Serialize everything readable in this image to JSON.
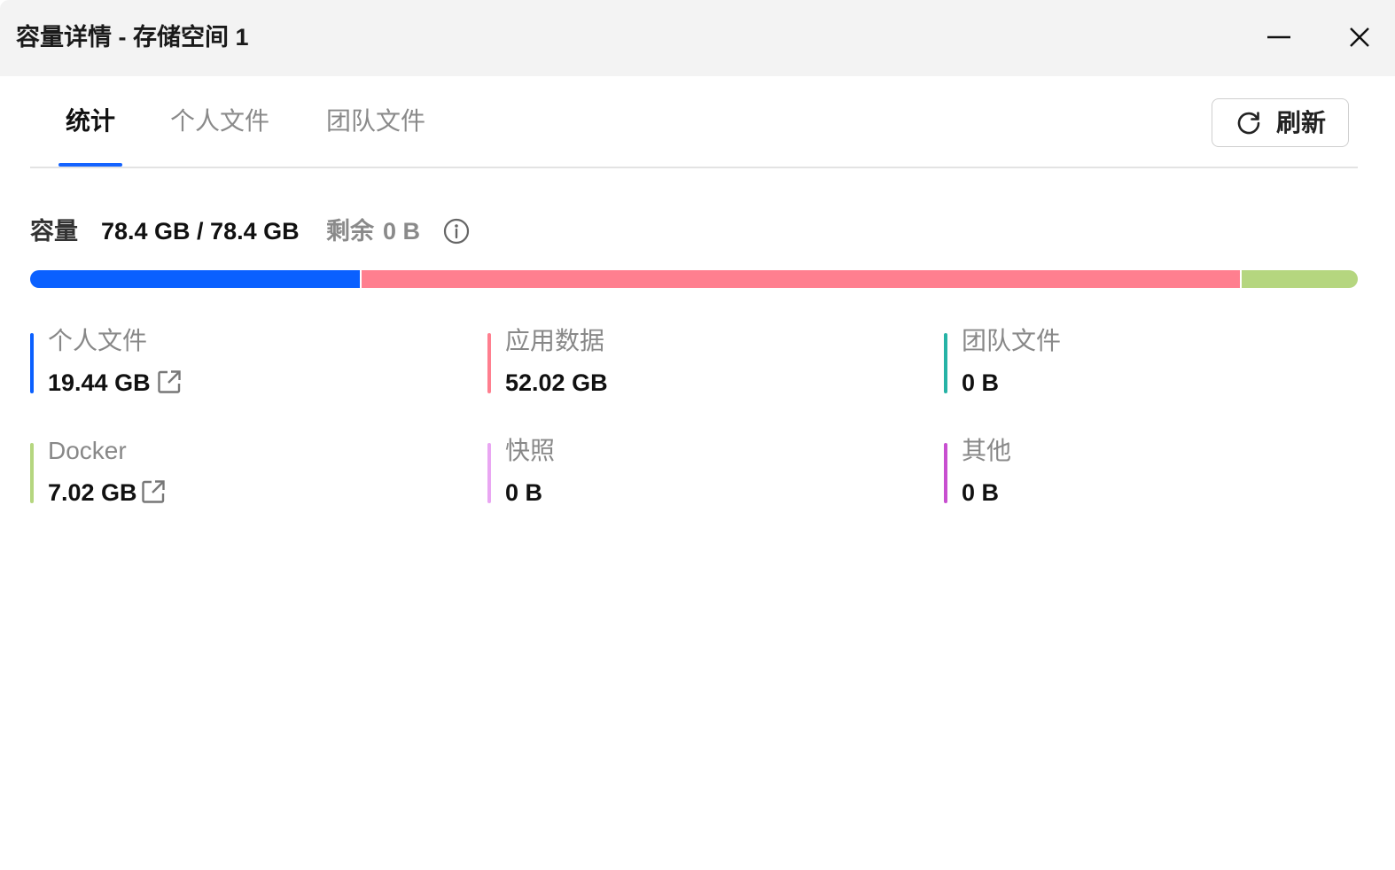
{
  "window": {
    "title": "容量详情 - 存储空间 1",
    "minimize_icon": "minimize-icon",
    "close_icon": "close-icon"
  },
  "tabs": [
    {
      "label": "统计",
      "active": true
    },
    {
      "label": "个人文件",
      "active": false
    },
    {
      "label": "团队文件",
      "active": false
    }
  ],
  "refresh": {
    "label": "刷新",
    "icon": "refresh-icon"
  },
  "capacity": {
    "label": "容量",
    "used_total": "78.4 GB / 78.4 GB",
    "remaining_label": "剩余",
    "remaining_value": "0 B",
    "info_icon": "info-icon"
  },
  "usage_bar": {
    "segments": [
      {
        "category": "个人文件",
        "fraction": 0.248,
        "color": "#0a60ff"
      },
      {
        "category": "应用数据",
        "fraction": 0.663,
        "color": "#ff7f8f"
      },
      {
        "category": "Docker",
        "fraction": 0.089,
        "color": "#b5d67f"
      }
    ]
  },
  "stats": [
    {
      "name": "个人文件",
      "value": "19.44 GB",
      "color": "#0a60ff",
      "has_link": true
    },
    {
      "name": "应用数据",
      "value": "52.02 GB",
      "color": "#ff7f8f",
      "has_link": false
    },
    {
      "name": "团队文件",
      "value": "0 B",
      "color": "#26b3a6",
      "has_link": false
    },
    {
      "name": "Docker",
      "value": "7.02 GB",
      "color": "#b5d67f",
      "has_link": true
    },
    {
      "name": "快照",
      "value": "0 B",
      "color": "#e9a6f2",
      "has_link": false
    },
    {
      "name": "其他",
      "value": "0 B",
      "color": "#c84fd0",
      "has_link": false
    }
  ]
}
